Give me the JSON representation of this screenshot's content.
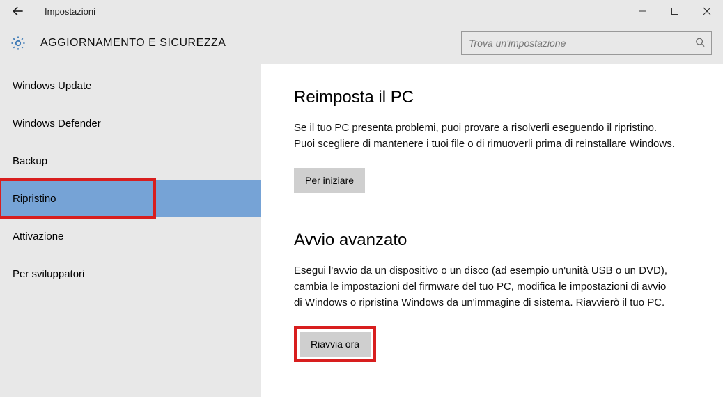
{
  "window": {
    "title": "Impostazioni"
  },
  "header": {
    "heading": "AGGIORNAMENTO E SICUREZZA",
    "search_placeholder": "Trova un'impostazione"
  },
  "sidebar": {
    "items": [
      {
        "label": "Windows Update"
      },
      {
        "label": "Windows Defender"
      },
      {
        "label": "Backup"
      },
      {
        "label": "Ripristino"
      },
      {
        "label": "Attivazione"
      },
      {
        "label": "Per sviluppatori"
      }
    ],
    "selected_index": 3
  },
  "content": {
    "reset": {
      "title": "Reimposta il PC",
      "desc": "Se il tuo PC presenta problemi, puoi provare a risolverli eseguendo il ripristino. Puoi scegliere di mantenere i tuoi file o di rimuoverli prima di reinstallare Windows.",
      "button": "Per iniziare"
    },
    "advanced": {
      "title": "Avvio avanzato",
      "desc": "Esegui l'avvio da un dispositivo o un disco (ad esempio un'unità USB o un DVD), cambia le impostazioni del firmware del tuo PC, modifica le impostazioni di avvio di Windows o ripristina Windows da un'immagine di sistema. Riavvierò il tuo PC.",
      "button": "Riavvia ora"
    }
  }
}
